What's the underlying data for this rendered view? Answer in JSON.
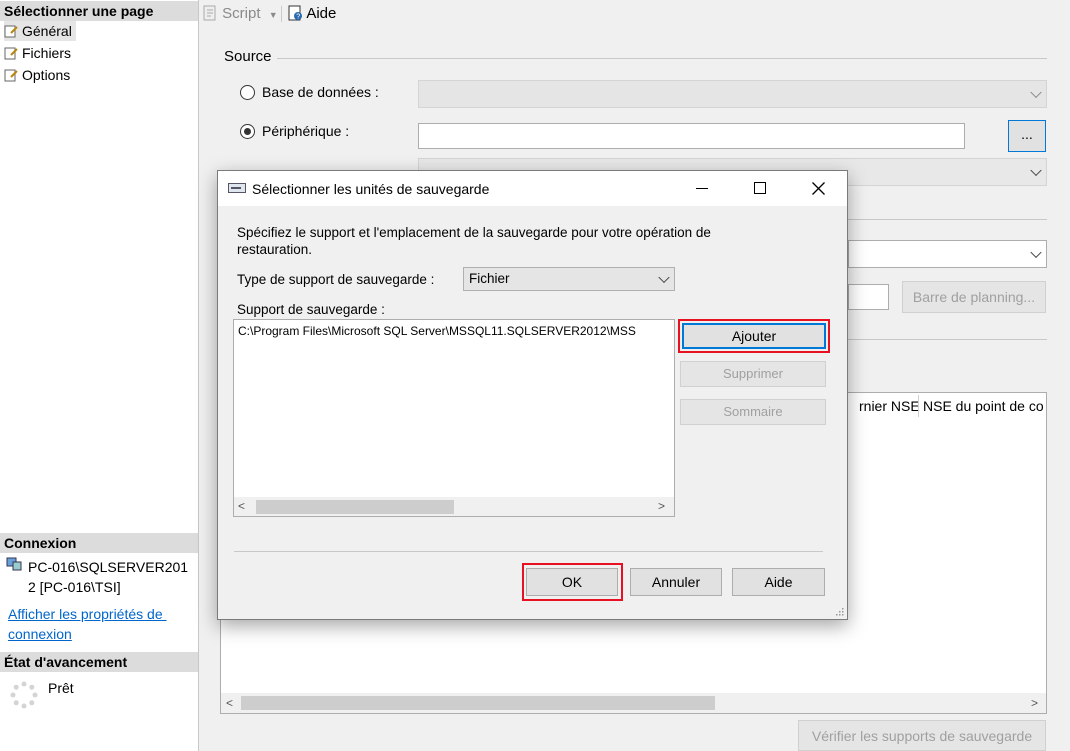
{
  "left_panel": {
    "select_page_header": "Sélectionner une page",
    "pages": [
      "Général",
      "Fichiers",
      "Options"
    ],
    "connection_header": "Connexion",
    "connection_server": "PC-016\\SQLSERVER201",
    "connection_server2": "2 [PC-016\\TSI]",
    "connection_link_1": "Afficher les propriétés de ",
    "connection_link_2": "connexion",
    "progress_header": "État d'avancement",
    "progress_status": "Prêt"
  },
  "toolbar": {
    "script_label": "Script",
    "help_label": "Aide"
  },
  "main": {
    "source_label": "Source",
    "database_label": "Base de données :",
    "device_label": "Périphérique :",
    "device_browse": "...",
    "device_value": "",
    "timeline_button": "Barre de planning...",
    "grid_col_last_lsn": "rnier NSE",
    "grid_col_checkpoint_lsn": "NSE du point de co",
    "verify_button": "Vérifier les supports de sauvegarde"
  },
  "dialog": {
    "title": "Sélectionner les unités de sauvegarde",
    "description_1": "Spécifiez le support et l'emplacement de la sauvegarde pour votre opération de",
    "description_2": "restauration.",
    "media_type_label": "Type de support de sauvegarde :",
    "media_type_value": "Fichier",
    "media_label": "Support de sauvegarde :",
    "media_items": [
      "C:\\Program Files\\Microsoft SQL Server\\MSSQL11.SQLSERVER2012\\MSS"
    ],
    "add_button": "Ajouter",
    "remove_button": "Supprimer",
    "contents_button": "Sommaire",
    "ok_button": "OK",
    "cancel_button": "Annuler",
    "help_button": "Aide"
  },
  "colors": {
    "highlight": "#e81123",
    "focus_blue": "#0078d7",
    "link": "#0066cc"
  }
}
